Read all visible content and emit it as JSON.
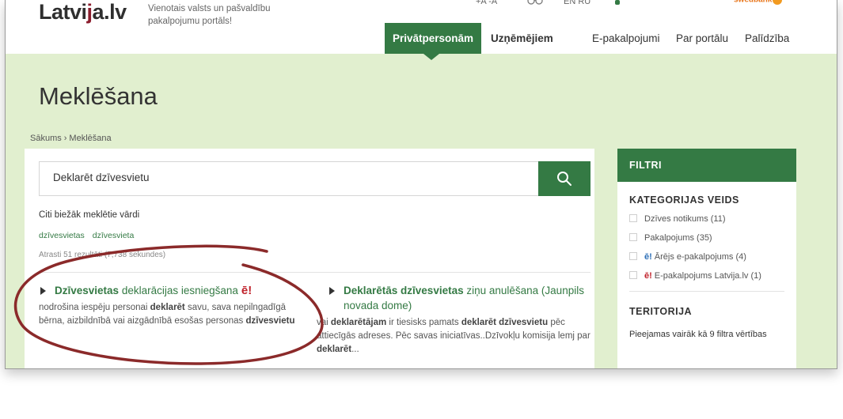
{
  "header": {
    "logo_text_left": "Latvi",
    "logo_mark": "j",
    "logo_text_right": "a.lv",
    "tagline": "Vienotais valsts un pašvaldību pakalpojumu portāls!",
    "font_size_controls": "+A  -A",
    "languages": "EN  RU",
    "sponsor": "swedbank",
    "icons": [
      "glasses-icon",
      "person-icon"
    ]
  },
  "nav": {
    "items": [
      {
        "label": "Privātpersonām",
        "active": true
      },
      {
        "label": "Uzņēmējiem"
      },
      {
        "label": "E-pakalpojumi"
      },
      {
        "label": "Par portālu"
      },
      {
        "label": "Palīdzība"
      }
    ]
  },
  "page": {
    "title": "Meklēšana",
    "breadcrumb": [
      "Sākums",
      "›",
      "Meklēšana"
    ]
  },
  "search": {
    "value": "Deklarēt dzīvesvietu",
    "frequent_title": "Citi biežāk meklētie vārdi",
    "tags": [
      "dzīvesvietas",
      "dzīvesvieta"
    ],
    "found": "Atrasti 51 rezultāti (7,738 sekundes)"
  },
  "results": [
    {
      "title_bold": "Dzīvesvietas",
      "title_rest": " deklarācijas iesniegšana",
      "badge": "ē!",
      "desc_parts": [
        "nodrošina iespēju personai ",
        "deklarēt",
        " savu, sava nepilngadīgā bērna, aizbildnībā vai aizgādnībā esošas personas ",
        "dzīvesvietu"
      ]
    },
    {
      "title_bold": "Deklarētās dzīvesvietas",
      "title_rest": " ziņu anulēšana (Jaunpils novada dome)",
      "desc_parts": [
        "vai ",
        "deklarētājam",
        " ir tiesisks pamats ",
        "deklarēt dzīvesvietu",
        " pēc attiecīgās adreses. Pēc savas iniciatīvas..Dzīvokļu komisija lemj par ",
        "deklarēt",
        "..."
      ]
    }
  ],
  "filters": {
    "heading": "FILTRI",
    "category_title": "KATEGORIJAS VEIDS",
    "category_items": [
      {
        "label": "Dzīves notikums (11)",
        "icon": ""
      },
      {
        "label": "Pakalpojums (35)",
        "icon": ""
      },
      {
        "label": "Ārējs e-pakalpojums (4)",
        "icon": "ē!"
      },
      {
        "label": "E-pakalpojums Latvija.lv (1)",
        "icon": "ē!"
      }
    ],
    "territory_title": "TERITORIJA",
    "territory_note": "Pieejamas vairāk kā 9 filtra vērtības"
  },
  "colors": {
    "brand_green": "#347a44",
    "hero_bg": "#e1efcf",
    "annotation_red": "#8b2a2a",
    "logo_red": "#8b1c2c"
  }
}
